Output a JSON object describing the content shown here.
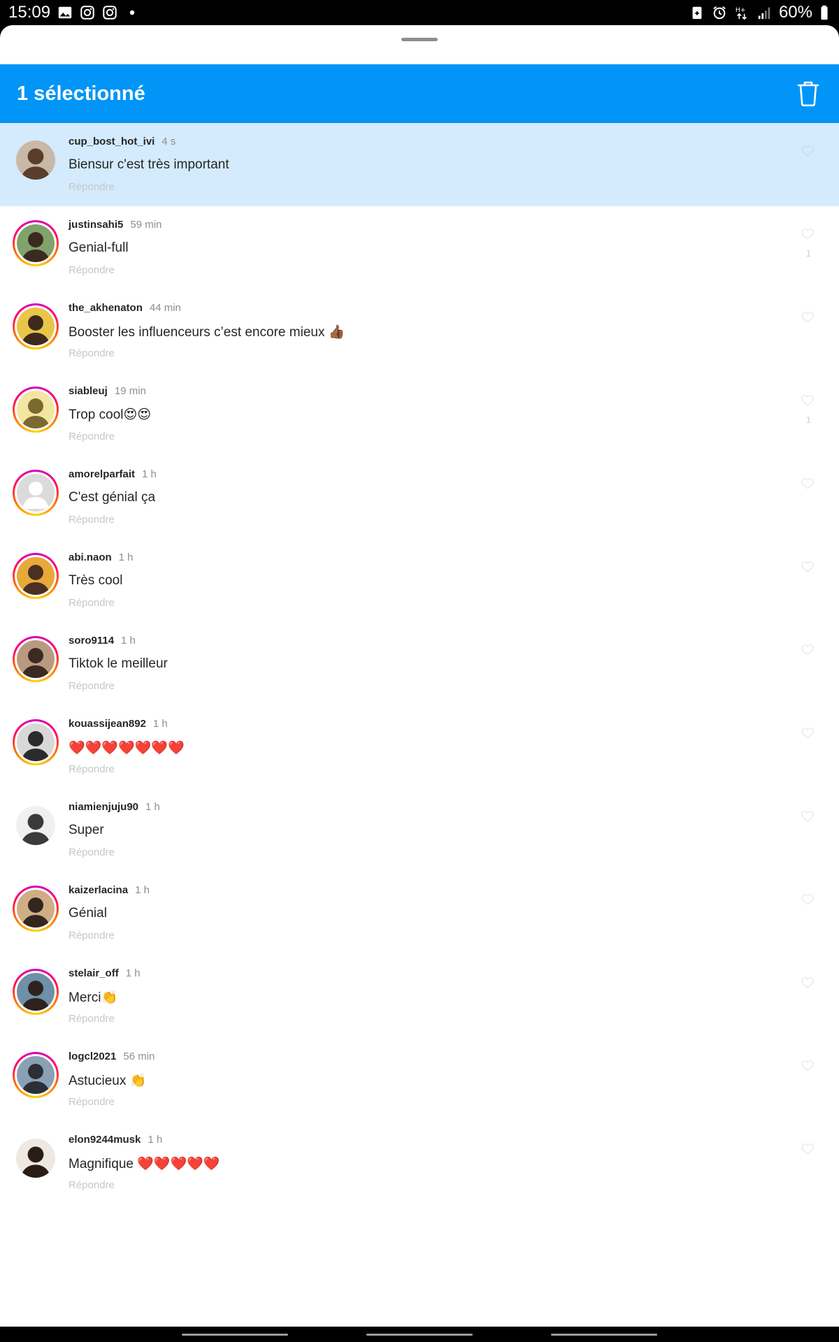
{
  "status_bar": {
    "time": "15:09",
    "left_icons": [
      "image-icon",
      "instagram-icon",
      "instagram-icon",
      "dot-icon"
    ],
    "right_icons": [
      "battery-saver-icon",
      "alarm-icon",
      "data-transfer-icon",
      "signal-icon"
    ],
    "battery": "60%"
  },
  "selection_bar": {
    "title": "1 sélectionné",
    "delete_icon": "trash-icon",
    "color": "#0095f6"
  },
  "reply_label": "Répondre",
  "comments": [
    {
      "username": "cup_bost_hot_ivi",
      "time": "4 s",
      "text": "Biensur c'est très important",
      "selected": true,
      "story_ring": false,
      "like_count": ""
    },
    {
      "username": "justinsahi5",
      "time": "59 min",
      "text": "Genial-full",
      "selected": false,
      "story_ring": true,
      "like_count": "1"
    },
    {
      "username": "the_akhenaton",
      "time": "44 min",
      "text": "Booster les influenceurs c’est encore mieux 👍🏾",
      "selected": false,
      "story_ring": true,
      "like_count": ""
    },
    {
      "username": "siableuj",
      "time": "19 min",
      "text": "Trop cool😍😍",
      "selected": false,
      "story_ring": true,
      "like_count": "1"
    },
    {
      "username": "amorelparfait",
      "time": "1 h",
      "text": "C'est génial ça",
      "selected": false,
      "story_ring": true,
      "like_count": ""
    },
    {
      "username": "abi.naon",
      "time": "1 h",
      "text": "Très cool",
      "selected": false,
      "story_ring": true,
      "like_count": ""
    },
    {
      "username": "soro9114",
      "time": "1 h",
      "text": "Tiktok le meilleur",
      "selected": false,
      "story_ring": true,
      "like_count": ""
    },
    {
      "username": "kouassijean892",
      "time": "1 h",
      "text": "❤️❤️❤️❤️❤️❤️❤️",
      "selected": false,
      "story_ring": true,
      "like_count": ""
    },
    {
      "username": "niamienjuju90",
      "time": "1 h",
      "text": "Super",
      "selected": false,
      "story_ring": false,
      "like_count": ""
    },
    {
      "username": "kaizerlacina",
      "time": "1 h",
      "text": "Génial",
      "selected": false,
      "story_ring": true,
      "like_count": ""
    },
    {
      "username": "stelair_off",
      "time": "1 h",
      "text": "Merci👏",
      "selected": false,
      "story_ring": true,
      "like_count": ""
    },
    {
      "username": "logcl2021",
      "time": "56 min",
      "text": "Astucieux 👏",
      "selected": false,
      "story_ring": true,
      "like_count": ""
    },
    {
      "username": "elon9244musk",
      "time": "1 h",
      "text": "Magnifique ❤️❤️❤️❤️❤️",
      "selected": false,
      "story_ring": false,
      "like_count": ""
    }
  ]
}
